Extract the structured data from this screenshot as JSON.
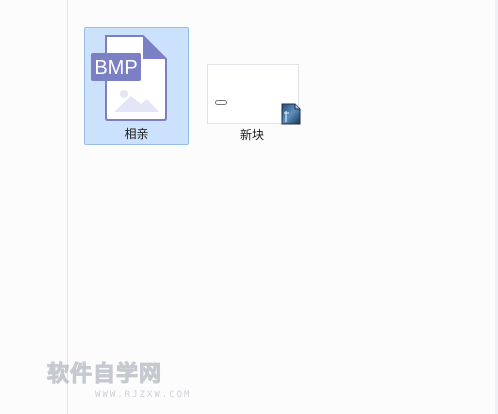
{
  "files": [
    {
      "name": "相亲",
      "type_badge": "BMP",
      "icon": "bmp-image-file-icon",
      "selected": true
    },
    {
      "name": "新块",
      "icon": "document-thumbnail-icon",
      "selected": false
    }
  ],
  "watermark": {
    "main": "软件自学网",
    "sub": "WWW.RJZXW.COM"
  },
  "colors": {
    "selection_bg": "#cce1fb",
    "selection_border": "#95bde9",
    "bmp_icon_accent": "#7b7fc4"
  }
}
